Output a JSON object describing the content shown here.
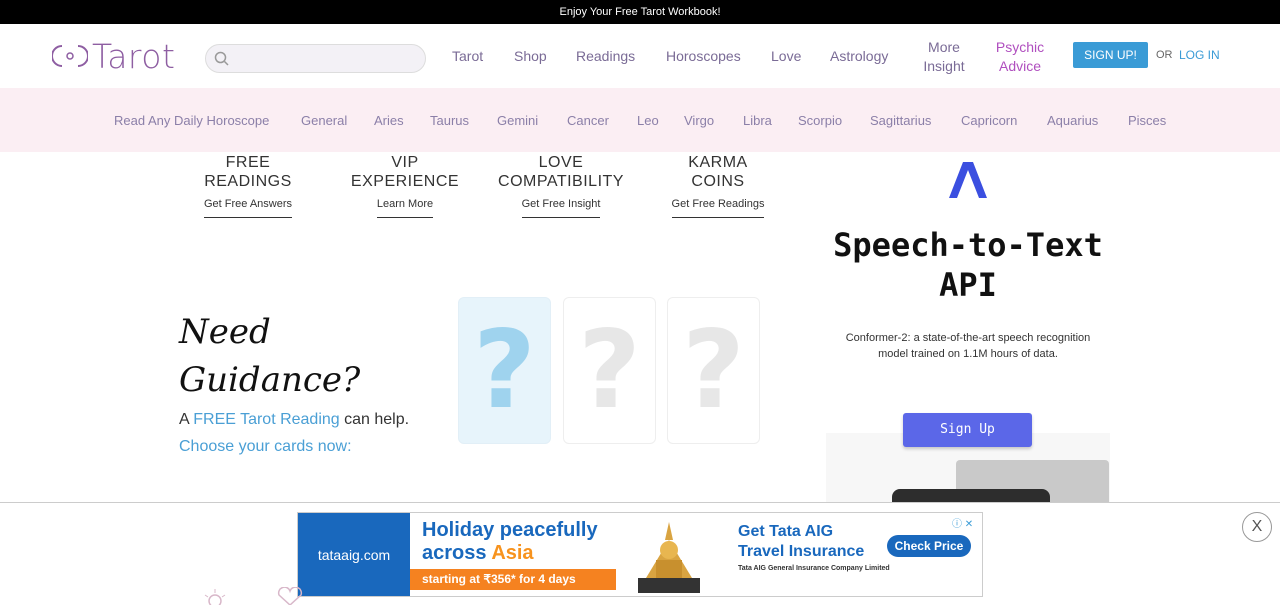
{
  "topbar": {
    "text": "Enjoy Your Free Tarot Workbook!"
  },
  "header": {
    "logo": "Tarot",
    "search_placeholder": "",
    "nav": [
      {
        "label": "Tarot"
      },
      {
        "label": "Shop"
      },
      {
        "label": "Readings"
      },
      {
        "label": "Horoscopes"
      },
      {
        "label": "Love"
      },
      {
        "label": "Astrology"
      },
      {
        "label": "More Insight"
      },
      {
        "label": "Psychic Advice"
      }
    ],
    "signup": "SIGN UP!",
    "or": "OR",
    "login": "LOG IN"
  },
  "subnav": [
    "Read Any Daily Horoscope",
    "General",
    "Aries",
    "Taurus",
    "Gemini",
    "Cancer",
    "Leo",
    "Virgo",
    "Libra",
    "Scorpio",
    "Sagittarius",
    "Capricorn",
    "Aquarius",
    "Pisces"
  ],
  "features": [
    {
      "title1": "FREE",
      "title2": "READINGS",
      "link": "Get Free Answers"
    },
    {
      "title1": "VIP",
      "title2": "EXPERIENCE",
      "link": "Learn More"
    },
    {
      "title1": "LOVE",
      "title2": "COMPATIBILITY",
      "link": "Get Free Insight"
    },
    {
      "title1": "KARMA",
      "title2": "COINS",
      "link": "Get Free Readings"
    }
  ],
  "guidance": {
    "line1": "Need",
    "line2": "Guidance?",
    "text_a": "A ",
    "text_link": "FREE Tarot Reading",
    "text_b": " can help.",
    "choose": "Choose your cards now:",
    "card_symbol": "?"
  },
  "side_ad": {
    "title1": "Speech-to-Text",
    "title2": "API",
    "desc": "Conformer-2: a state-of-the-art speech recognition model trained on 1.1M hours of data.",
    "button": "Sign Up"
  },
  "banner_ad": {
    "brand": "tataaig.com",
    "headline1": "Holiday peacefully",
    "headline2": "across ",
    "headline2_highlight": "Asia",
    "strip": "starting at ₹356* for 4 days",
    "title1": "Get Tata AIG",
    "title2": "Travel Insurance",
    "cta": "Check Price",
    "company": "Tata AIG General Insurance Company Limited",
    "adchoice": "ⓘ ✕"
  },
  "close_button": "X",
  "colors": {
    "accent": "#3a9bd6",
    "brand": "#8e5ea2",
    "subnav_bg": "#fbeef3"
  }
}
